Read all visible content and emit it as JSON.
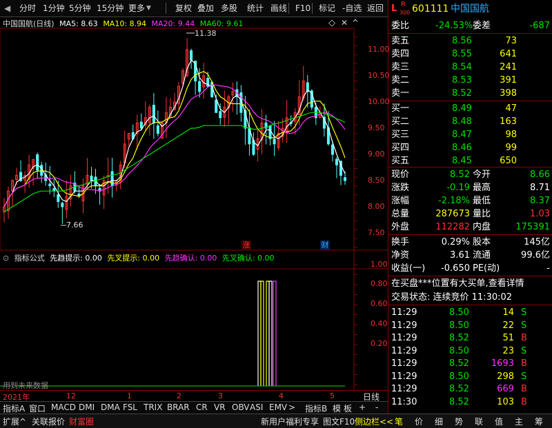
{
  "toolbar": {
    "items": [
      "分时",
      "1分钟",
      "5分钟",
      "15分钟",
      "更多",
      "复权",
      "叠加",
      "多股",
      "统计",
      "画线",
      "F10",
      "标记",
      "-自选",
      "返回"
    ]
  },
  "chart": {
    "stock_label": "中国国航(日线)",
    "ma": [
      {
        "text": "MA5: 8.63",
        "color": "#ffffff"
      },
      {
        "text": "MA10: 8.94",
        "color": "#ffff00"
      },
      {
        "text": "MA20: 9.44",
        "color": "#ff33ff"
      },
      {
        "text": "MA60: 9.61",
        "color": "#00e000"
      }
    ],
    "high_mark": "11.38",
    "low_mark": "7.66",
    "price_axis": [
      "11.00",
      "10.50",
      "10.00",
      "9.50",
      "9.00",
      "8.50",
      "8.00",
      "7.50"
    ],
    "indicator_axis": [
      "1.00",
      "0.80",
      "0.60",
      "0.40",
      "0.20"
    ],
    "badges": {
      "zhang": "涨",
      "cai": "财"
    },
    "future_note": "用到未来数据"
  },
  "indicator": {
    "title": "指标公式",
    "items": [
      {
        "text": "先趋提示: 0.00",
        "color": "#ffffff"
      },
      {
        "text": "先叉提示: 0.00",
        "color": "#ffff00"
      },
      {
        "text": "先趋确认: 0.00",
        "color": "#ff33ff"
      },
      {
        "text": "先叉确认: 0.00",
        "color": "#00e000"
      }
    ]
  },
  "xaxis": {
    "year": "2021年",
    "ticks": [
      "12",
      "1",
      "2",
      "3",
      "4",
      "5"
    ],
    "period": "日线"
  },
  "quote": {
    "code": "601111",
    "name": "中国国航",
    "flag_l": "L",
    "flag_r": "R",
    "flag_num": "300",
    "weibi_label": "委比",
    "weibi": "-24.53%",
    "weicha_label": "委差",
    "weicha": "-687",
    "asks": [
      {
        "label": "卖五",
        "price": "8.56",
        "vol": "73"
      },
      {
        "label": "卖四",
        "price": "8.55",
        "vol": "641"
      },
      {
        "label": "卖三",
        "price": "8.54",
        "vol": "241"
      },
      {
        "label": "卖二",
        "price": "8.53",
        "vol": "391"
      },
      {
        "label": "卖一",
        "price": "8.52",
        "vol": "398"
      }
    ],
    "bids": [
      {
        "label": "买一",
        "price": "8.49",
        "vol": "47"
      },
      {
        "label": "买二",
        "price": "8.48",
        "vol": "163"
      },
      {
        "label": "买三",
        "price": "8.47",
        "vol": "98"
      },
      {
        "label": "买四",
        "price": "8.46",
        "vol": "99"
      },
      {
        "label": "买五",
        "price": "8.45",
        "vol": "650"
      }
    ],
    "stats": [
      {
        "l1": "现价",
        "v1": "8.52",
        "c1": "green",
        "l2": "今开",
        "v2": "8.66",
        "c2": "green"
      },
      {
        "l1": "涨跌",
        "v1": "-0.19",
        "c1": "green",
        "l2": "最高",
        "v2": "8.71",
        "c2": "white"
      },
      {
        "l1": "涨幅",
        "v1": "-2.18%",
        "c1": "green",
        "l2": "最低",
        "v2": "8.37",
        "c2": "green"
      },
      {
        "l1": "总量",
        "v1": "287673",
        "c1": "yellow",
        "l2": "量比",
        "v2": "1.03",
        "c2": "red"
      },
      {
        "l1": "外盘",
        "v1": "112282",
        "c1": "red",
        "l2": "内盘",
        "v2": "175391",
        "c2": "green"
      }
    ],
    "stats2": [
      {
        "l1": "换手",
        "v1": "0.29%",
        "l2": "股本",
        "v2": "145亿"
      },
      {
        "l1": "净资",
        "v1": "3.61",
        "l2": "流通",
        "v2": "99.6亿"
      },
      {
        "l1": "收益(一)",
        "v1": "-0.650",
        "l2": "PE(动)",
        "v2": "-"
      }
    ],
    "notice": "在买盘***位置有大买单,查看详情",
    "trade_status": "交易状态: 连续竞价 11:30:02",
    "ticks": [
      {
        "t": "11:29",
        "p": "8.50",
        "v": "14",
        "vc": "yellow",
        "s": "S"
      },
      {
        "t": "11:29",
        "p": "8.50",
        "v": "22",
        "vc": "yellow",
        "s": "S"
      },
      {
        "t": "11:29",
        "p": "8.52",
        "v": "51",
        "vc": "yellow",
        "s": "B"
      },
      {
        "t": "11:29",
        "p": "8.50",
        "v": "23",
        "vc": "yellow",
        "s": "S"
      },
      {
        "t": "11:29",
        "p": "8.52",
        "v": "1693",
        "vc": "mag",
        "s": "B"
      },
      {
        "t": "11:29",
        "p": "8.50",
        "v": "298",
        "vc": "yellow",
        "s": "S"
      },
      {
        "t": "11:29",
        "p": "8.52",
        "v": "669",
        "vc": "mag",
        "s": "B"
      },
      {
        "t": "11:30",
        "p": "8.52",
        "v": "103",
        "vc": "yellow",
        "s": "B"
      }
    ]
  },
  "bottom_tabs": [
    "指标A",
    "窗口",
    "MACD",
    "DMI",
    "DMA",
    "FSL",
    "TRIX",
    "BRAR",
    "CR",
    "VR",
    "OBV",
    "ASI",
    "EMV",
    ">",
    "指标B",
    "模",
    "板",
    "+",
    "-"
  ],
  "status": {
    "left": [
      "扩展^",
      "关联报价",
      "财富圈"
    ],
    "mid": [
      "新用户福利专享",
      "图文F10",
      "侧边栏<<"
    ],
    "right": [
      "笔",
      "价",
      "细",
      "势",
      "联",
      "值",
      "主",
      "筹"
    ]
  },
  "chart_data": {
    "type": "line",
    "price_range": [
      7.3,
      11.6
    ],
    "close": [
      8.0,
      8.3,
      8.5,
      8.6,
      8.5,
      8.6,
      8.8,
      8.9,
      8.7,
      8.6,
      8.5,
      8.4,
      8.3,
      8.1,
      8.0,
      8.2,
      8.4,
      8.3,
      8.2,
      8.4,
      8.6,
      8.5,
      8.4,
      8.3,
      8.5,
      8.6,
      8.4,
      8.5,
      8.8,
      9.2,
      9.4,
      9.3,
      9.6,
      9.5,
      9.7,
      9.9,
      9.6,
      9.4,
      9.6,
      9.8,
      9.9,
      10.0,
      10.3,
      10.6,
      11.0,
      10.8,
      10.4,
      10.2,
      10.5,
      10.3,
      10.1,
      9.8,
      9.7,
      9.9,
      10.1,
      10.2,
      10.1,
      9.8,
      9.5,
      9.2,
      9.0,
      9.3,
      9.6,
      9.5,
      9.3,
      9.2,
      9.4,
      9.5,
      9.7,
      9.6,
      9.8,
      10.1,
      10.4,
      10.2,
      9.9,
      9.7,
      9.8,
      9.5,
      9.2,
      9.0,
      8.8,
      8.6,
      8.5
    ],
    "ma60": [
      7.9,
      7.95,
      8.0,
      8.05,
      8.1,
      8.15,
      8.2,
      8.25,
      8.28,
      8.3,
      8.3,
      8.3,
      8.3,
      8.3,
      8.3,
      8.32,
      8.35,
      8.38,
      8.4,
      8.42,
      8.45,
      8.48,
      8.5,
      8.52,
      8.55,
      8.58,
      8.6,
      8.62,
      8.65,
      8.7,
      8.75,
      8.8,
      8.85,
      8.9,
      8.95,
      9.0,
      9.05,
      9.1,
      9.15,
      9.2,
      9.25,
      9.3,
      9.35,
      9.4,
      9.45,
      9.5,
      9.5,
      9.52,
      9.55,
      9.55,
      9.55,
      9.55,
      9.55,
      9.55,
      9.55,
      9.55,
      9.55,
      9.55,
      9.52,
      9.5,
      9.48,
      9.48,
      9.5,
      9.52,
      9.55,
      9.58,
      9.6,
      9.62,
      9.65,
      9.68,
      9.7,
      9.72,
      9.75,
      9.78,
      9.8,
      9.8,
      9.8,
      9.78,
      9.75,
      9.72,
      9.68,
      9.65,
      9.61
    ],
    "indicator_range": [
      0,
      1.1
    ]
  }
}
